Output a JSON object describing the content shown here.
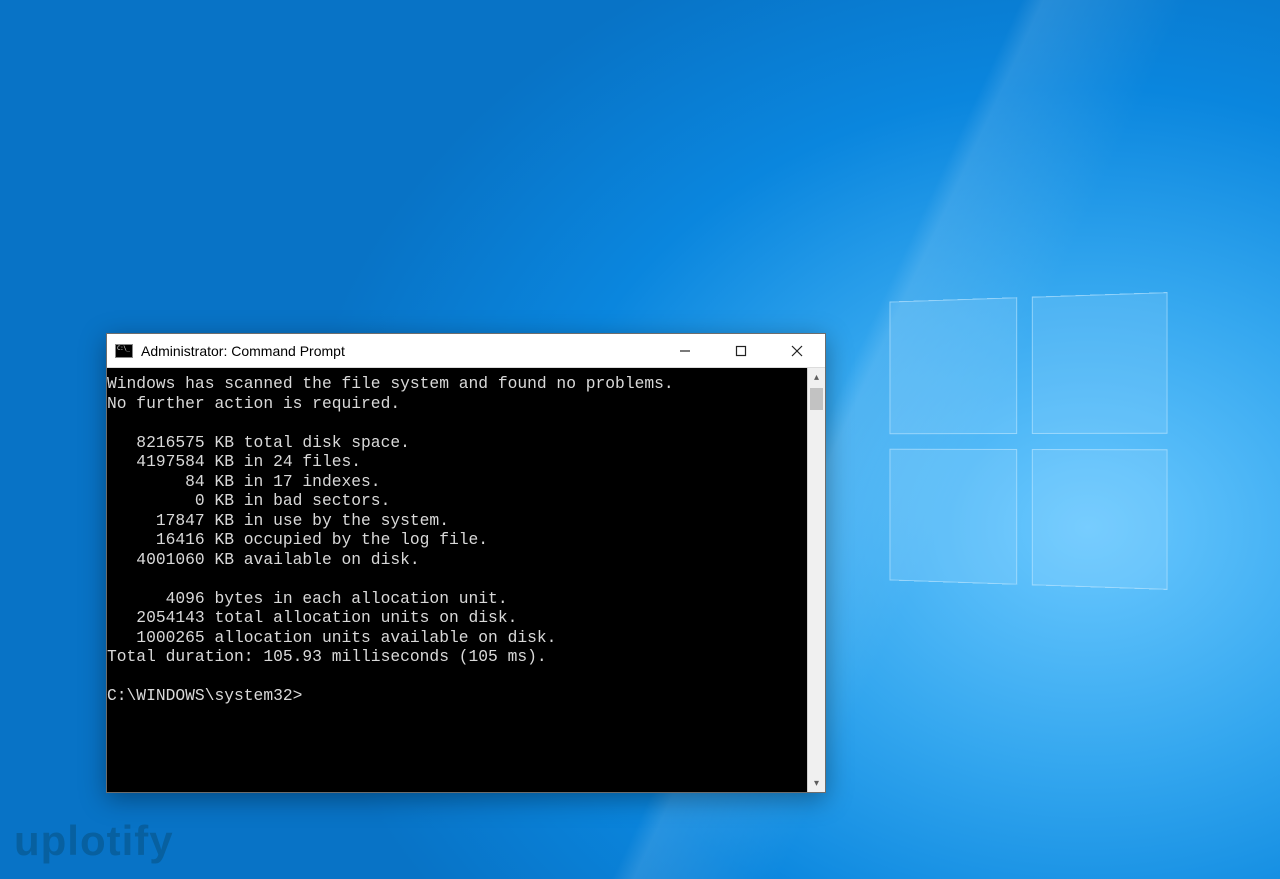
{
  "window": {
    "title": "Administrator: Command Prompt"
  },
  "terminal": {
    "lines": [
      "Windows has scanned the file system and found no problems.",
      "No further action is required.",
      "",
      "   8216575 KB total disk space.",
      "   4197584 KB in 24 files.",
      "        84 KB in 17 indexes.",
      "         0 KB in bad sectors.",
      "     17847 KB in use by the system.",
      "     16416 KB occupied by the log file.",
      "   4001060 KB available on disk.",
      "",
      "      4096 bytes in each allocation unit.",
      "   2054143 total allocation units on disk.",
      "   1000265 allocation units available on disk.",
      "Total duration: 105.93 milliseconds (105 ms).",
      "",
      "C:\\WINDOWS\\system32>"
    ]
  },
  "watermark": "uplotify"
}
